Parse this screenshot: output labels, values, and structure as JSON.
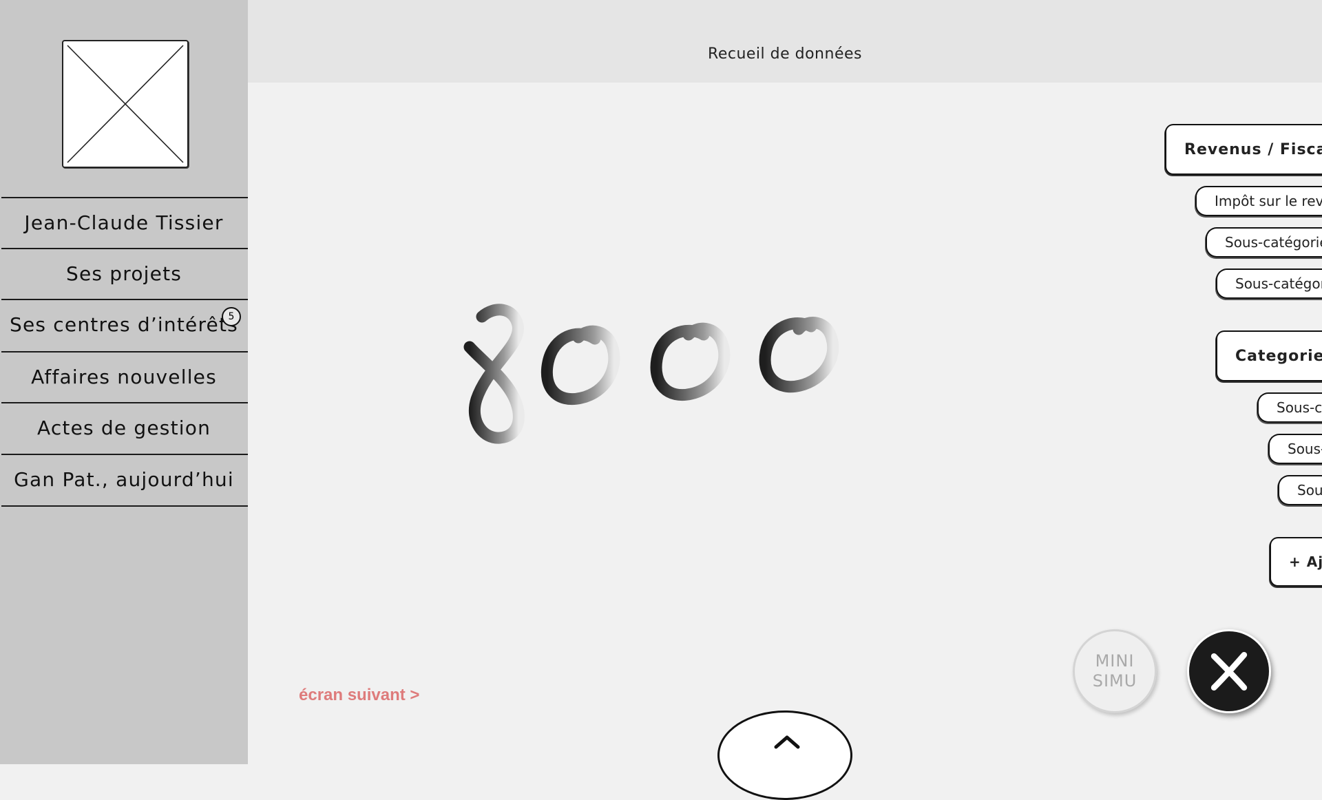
{
  "header": {
    "title": "Recueil de données"
  },
  "sidebar": {
    "items": [
      {
        "label": "Jean-Claude Tissier"
      },
      {
        "label": "Ses projets"
      },
      {
        "label": "Ses centres d’intérêts",
        "badge": "5"
      },
      {
        "label": "Affaires nouvelles"
      },
      {
        "label": "Actes de gestion"
      },
      {
        "label": "Gan Pat., aujourd’hui"
      }
    ]
  },
  "main": {
    "value": "8000"
  },
  "right_panel": {
    "groups": [
      {
        "label": "Revenus / Fiscalité",
        "items": [
          "Impôt sur le revenu",
          "Sous-catégorie",
          "Sous-catégorie"
        ]
      },
      {
        "label": "Categorie",
        "items": [
          "Sous-catégorie",
          "Sous-catégorie",
          "Sous-catégorie"
        ]
      }
    ],
    "add_label": "+ Ajouter"
  },
  "footer": {
    "next_label": "écran suivant >",
    "mini_simu_line1": "MINI",
    "mini_simu_line2": "SIMU"
  },
  "icons": {
    "logo": "image-placeholder-icon",
    "close": "close-icon",
    "expand": "chevron-up-icon"
  },
  "colors": {
    "accent_link": "#de7b7b",
    "sidebar_bg": "#c8c8c8",
    "header_bg": "#e5e5e5",
    "main_bg": "#f1f1f1"
  }
}
